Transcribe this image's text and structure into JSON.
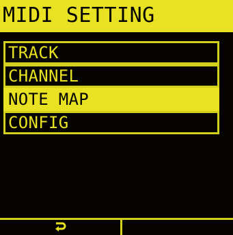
{
  "header": {
    "title": "MIDI SETTING"
  },
  "menu": {
    "items": [
      {
        "label": "TRACK",
        "selected": false
      },
      {
        "label": "CHANNEL",
        "selected": false
      },
      {
        "label": "NOTE MAP",
        "selected": true
      },
      {
        "label": "CONFIG",
        "selected": false
      }
    ]
  },
  "footer": {
    "left_key_icon": "return-icon",
    "right_key_label": ""
  },
  "colors": {
    "accent": "#e8e223",
    "border": "#d2cf1d",
    "background": "#050400"
  }
}
